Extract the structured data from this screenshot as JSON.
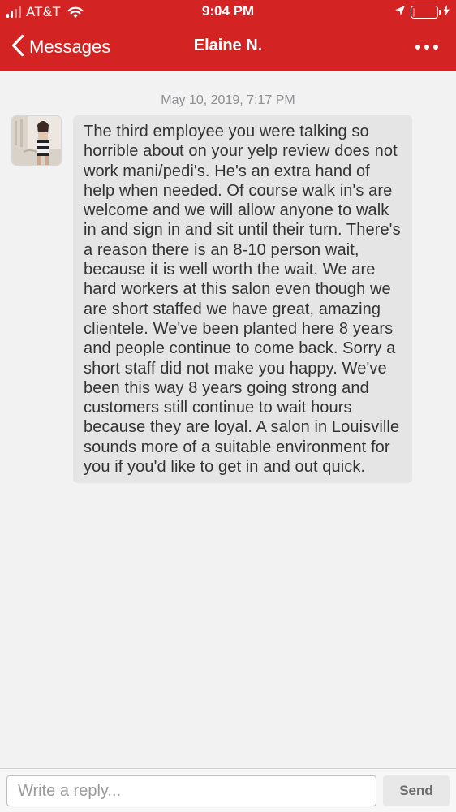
{
  "status_bar": {
    "carrier": "AT&T",
    "time": "9:04 PM",
    "signal_bars_active": 2,
    "signal_bars_total": 4,
    "battery_level": 0.1,
    "icons": [
      "signal-icon",
      "wifi-icon",
      "location-arrow-icon",
      "battery-icon",
      "charging-bolt-icon"
    ]
  },
  "header": {
    "back_label": "Messages",
    "title": "Elaine N.",
    "more_icon": "more-icon"
  },
  "conversation": {
    "timestamp": "May 10, 2019, 7:17 PM",
    "messages": [
      {
        "sender": "Elaine N.",
        "text": "The third employee you were talking so horrible about on your yelp review does not work mani/pedi's. He's an extra hand of help when needed. Of course walk in's are welcome and we will allow anyone to walk in and sign in and sit until their turn. There's a reason there is an 8-10 person wait, because it is well worth the wait. We are hard workers at this salon even though we are short staffed we have great, amazing clientele. We've been planted here 8 years and people continue to come back. Sorry a short staff did not make you happy. We've been this way 8 years going strong and customers still continue to wait hours because they are loyal. A salon  in Louisville sounds more of a suitable environment for you if you'd like to get in and out quick."
      }
    ]
  },
  "reply": {
    "placeholder": "Write a reply...",
    "value": "",
    "send_label": "Send"
  },
  "colors": {
    "brand": "#d32323",
    "bubble": "#e5e5e5",
    "background": "#f2f2f2"
  }
}
